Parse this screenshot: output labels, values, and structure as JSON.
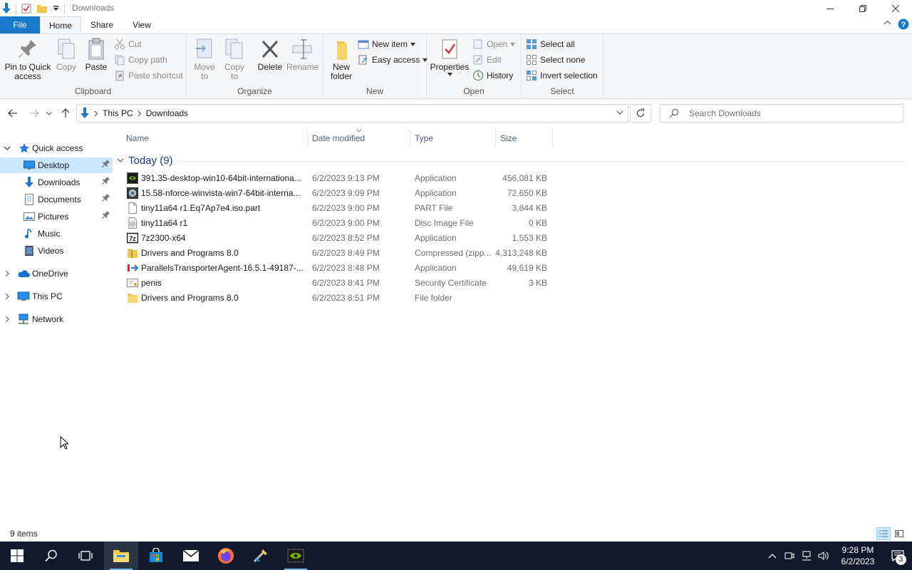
{
  "window": {
    "title": "Downloads"
  },
  "ribbon_tabs": {
    "file": "File",
    "home": "Home",
    "share": "Share",
    "view": "View"
  },
  "ribbon": {
    "clipboard": {
      "label": "Clipboard",
      "pin_line1": "Pin to Quick",
      "pin_line2": "access",
      "copy": "Copy",
      "paste": "Paste",
      "cut": "Cut",
      "copy_path": "Copy path",
      "paste_shortcut": "Paste shortcut"
    },
    "organize": {
      "label": "Organize",
      "move_line1": "Move",
      "move_line2": "to",
      "copy_line1": "Copy",
      "copy_line2": "to",
      "delete": "Delete",
      "rename": "Rename"
    },
    "new": {
      "label": "New",
      "folder_line1": "New",
      "folder_line2": "folder",
      "new_item": "New item",
      "easy_access": "Easy access"
    },
    "open": {
      "label": "Open",
      "properties": "Properties",
      "open": "Open",
      "edit": "Edit",
      "history": "History"
    },
    "select": {
      "label": "Select",
      "select_all": "Select all",
      "select_none": "Select none",
      "invert": "Invert selection"
    }
  },
  "address": {
    "crumbs": [
      "This PC",
      "Downloads"
    ]
  },
  "search": {
    "placeholder": "Search Downloads"
  },
  "nav": {
    "quick_access": "Quick access",
    "items": [
      {
        "label": "Desktop",
        "icon": "desktop-icon",
        "pinned": true
      },
      {
        "label": "Downloads",
        "icon": "downloads-icon",
        "pinned": true
      },
      {
        "label": "Documents",
        "icon": "documents-icon",
        "pinned": true
      },
      {
        "label": "Pictures",
        "icon": "pictures-icon",
        "pinned": true
      },
      {
        "label": "Music",
        "icon": "music-icon",
        "pinned": false
      },
      {
        "label": "Videos",
        "icon": "videos-icon",
        "pinned": false
      }
    ],
    "onedrive": "OneDrive",
    "this_pc": "This PC",
    "network": "Network"
  },
  "columns": {
    "name": "Name",
    "date": "Date modified",
    "type": "Type",
    "size": "Size"
  },
  "group": {
    "label": "Today (9)"
  },
  "files": [
    {
      "name": "391.35-desktop-win10-64bit-internationa...",
      "date": "6/2/2023 9:13 PM",
      "type": "Application",
      "size": "456,081 KB",
      "icon": "nvidia-installer-icon"
    },
    {
      "name": "15.58-nforce-winvista-win7-64bit-interna...",
      "date": "6/2/2023 9:09 PM",
      "type": "Application",
      "size": "72,650 KB",
      "icon": "installer-icon"
    },
    {
      "name": "tiny11a64 r1.Eq7Ap7e4.iso.part",
      "date": "6/2/2023 9:00 PM",
      "type": "PART File",
      "size": "3,844 KB",
      "icon": "blank-file-icon"
    },
    {
      "name": "tiny11a64 r1",
      "date": "6/2/2023 9:00 PM",
      "type": "Disc Image File",
      "size": "0 KB",
      "icon": "disc-image-icon"
    },
    {
      "name": "7z2300-x64",
      "date": "6/2/2023 8:52 PM",
      "type": "Application",
      "size": "1,553 KB",
      "icon": "7zip-icon"
    },
    {
      "name": "Drivers and Programs 8.0",
      "date": "6/2/2023 8:49 PM",
      "type": "Compressed (zipp...",
      "size": "4,313,248 KB",
      "icon": "zip-folder-icon"
    },
    {
      "name": "ParallelsTransporterAgent-16.5.1-49187-...",
      "date": "6/2/2023 8:48 PM",
      "type": "Application",
      "size": "49,619 KB",
      "icon": "parallels-icon"
    },
    {
      "name": "penis",
      "date": "6/2/2023 8:41 PM",
      "type": "Security Certificate",
      "size": "3 KB",
      "icon": "certificate-icon"
    },
    {
      "name": "Drivers and Programs 8.0",
      "date": "6/2/2023 8:51 PM",
      "type": "File folder",
      "size": "",
      "icon": "folder-icon"
    }
  ],
  "status": {
    "items": "9 items"
  },
  "taskbar": {
    "time": "9:28 PM",
    "date": "6/2/2023",
    "notifications": "3"
  },
  "colors": {
    "accent": "#1979ca",
    "selection": "#cce8ff",
    "taskbar": "#101a2b",
    "group_header": "#1e3287"
  }
}
